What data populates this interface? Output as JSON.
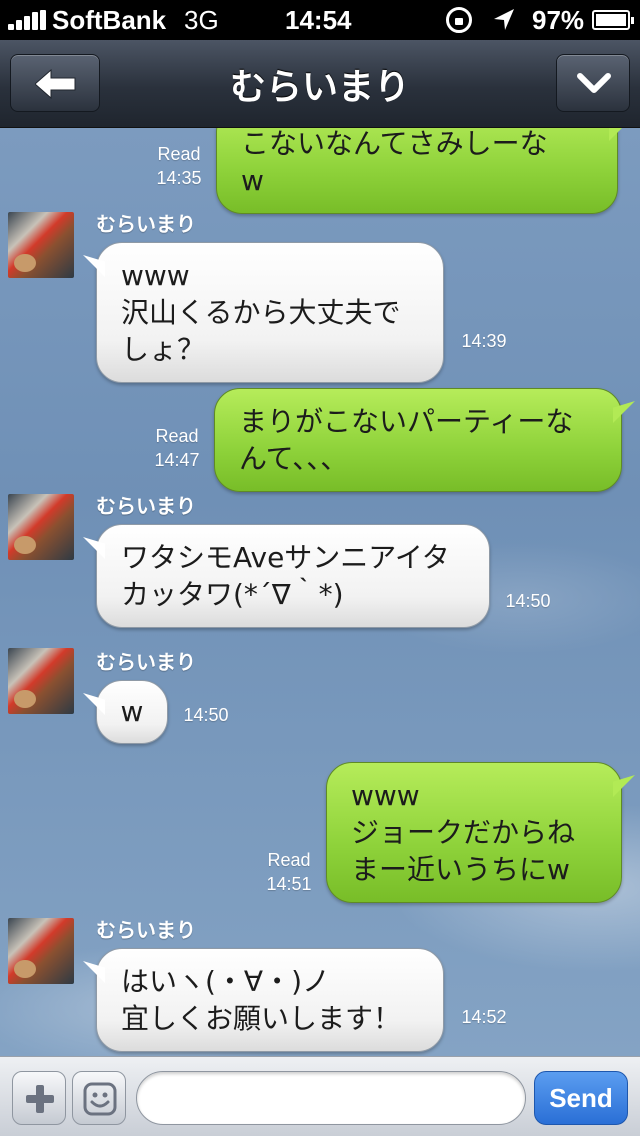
{
  "status_bar": {
    "carrier": "SoftBank",
    "network": "3G",
    "time": "14:54",
    "battery_percent": "97%"
  },
  "header": {
    "title": "むらいまり",
    "back_icon": "arrow-left-icon",
    "dropdown_icon": "chevron-down-icon"
  },
  "messages": [
    {
      "direction": "out",
      "text": "こないなんてさみしーな\nw",
      "read": "Read",
      "time": "14:35"
    },
    {
      "direction": "in",
      "sender": "むらいまり",
      "text": "www\n沢山くるから大丈夫で\nしょ？",
      "time": "14:39"
    },
    {
      "direction": "out",
      "text": "まりがこないパーティーな\nんて、、、",
      "read": "Read",
      "time": "14:47"
    },
    {
      "direction": "in",
      "sender": "むらいまり",
      "text": "ワタシモAveサンニアイタ\nカッタワ(*´∇｀*)",
      "time": "14:50"
    },
    {
      "direction": "in",
      "sender": "むらいまり",
      "text": "w",
      "time": "14:50"
    },
    {
      "direction": "out",
      "text": "www\nジョークだからね\nまー近いうちにw",
      "read": "Read",
      "time": "14:51"
    },
    {
      "direction": "in",
      "sender": "むらいまり",
      "text": "はいヽ(・∀・)ノ\n宜しくお願いします！",
      "time": "14:52"
    }
  ],
  "input_bar": {
    "send_label": "Send",
    "message_value": "",
    "plus_icon": "plus-icon",
    "emoji_icon": "emoji-icon"
  },
  "colors": {
    "outgoing_bubble": "#8ed23a",
    "incoming_bubble": "#ffffff",
    "send_button": "#2a6fd6"
  }
}
